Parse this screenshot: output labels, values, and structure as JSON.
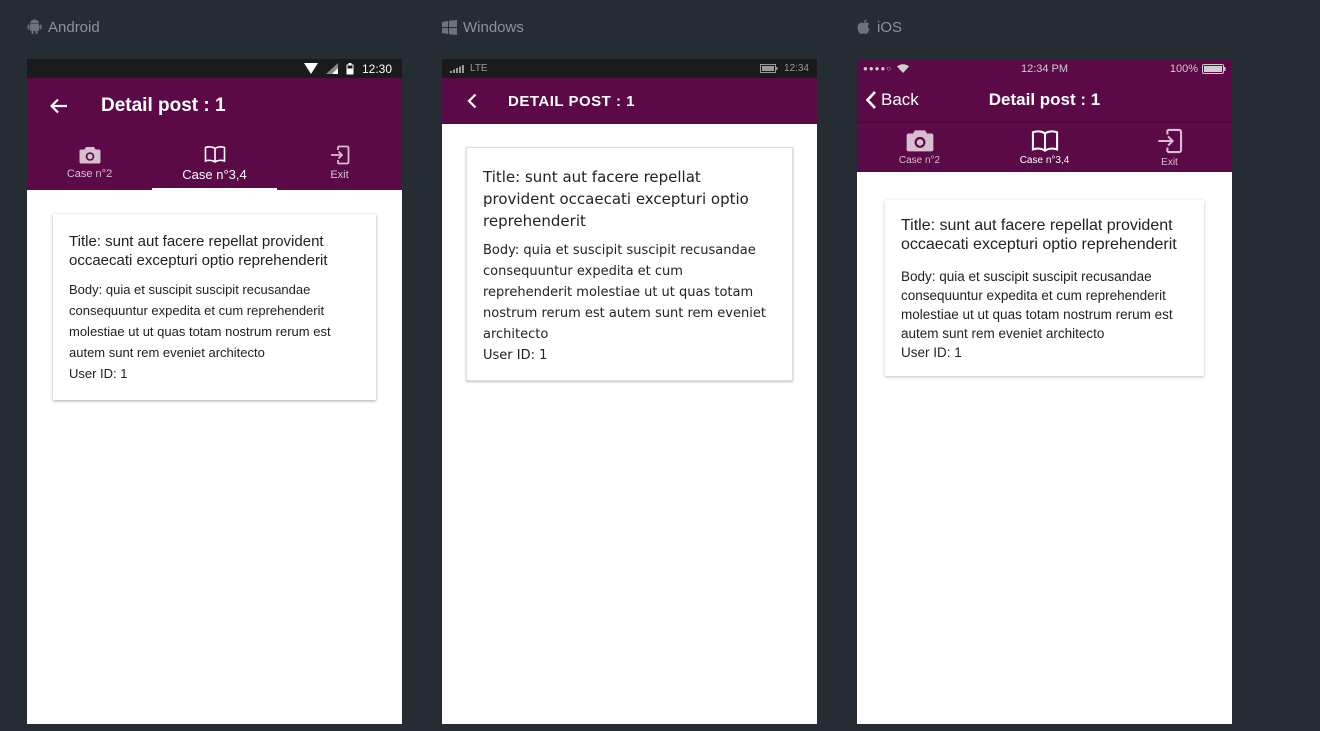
{
  "platforms": {
    "android": "Android",
    "windows": "Windows",
    "ios": "iOS"
  },
  "colors": {
    "header": "#5b0a47",
    "background": "#262c33"
  },
  "android": {
    "time": "12:30",
    "title": "Detail post : 1",
    "tabs": [
      {
        "label": "Case n°2",
        "icon": "camera-icon"
      },
      {
        "label": "Case n°3,4",
        "icon": "book-icon"
      },
      {
        "label": "Exit",
        "icon": "exit-icon"
      }
    ]
  },
  "windows": {
    "network": "LTE",
    "time": "12:34",
    "title": "DETAIL POST : 1"
  },
  "ios": {
    "carrier": "●●●●○",
    "time": "12:34 PM",
    "battery": "100%",
    "back_label": "Back",
    "title": "Detail post : 1",
    "tabs": [
      {
        "label": "Case n°2",
        "icon": "camera-icon"
      },
      {
        "label": "Case n°3,4",
        "icon": "book-icon"
      },
      {
        "label": "Exit",
        "icon": "exit-icon"
      }
    ]
  },
  "post": {
    "title": "Title: sunt aut facere repellat provident occaecati excepturi optio reprehenderit",
    "body": "Body: quia et suscipit suscipit recusandae consequuntur expedita et cum reprehenderit molestiae ut ut quas totam nostrum rerum est autem sunt rem eveniet architecto",
    "user": "User ID: 1"
  }
}
